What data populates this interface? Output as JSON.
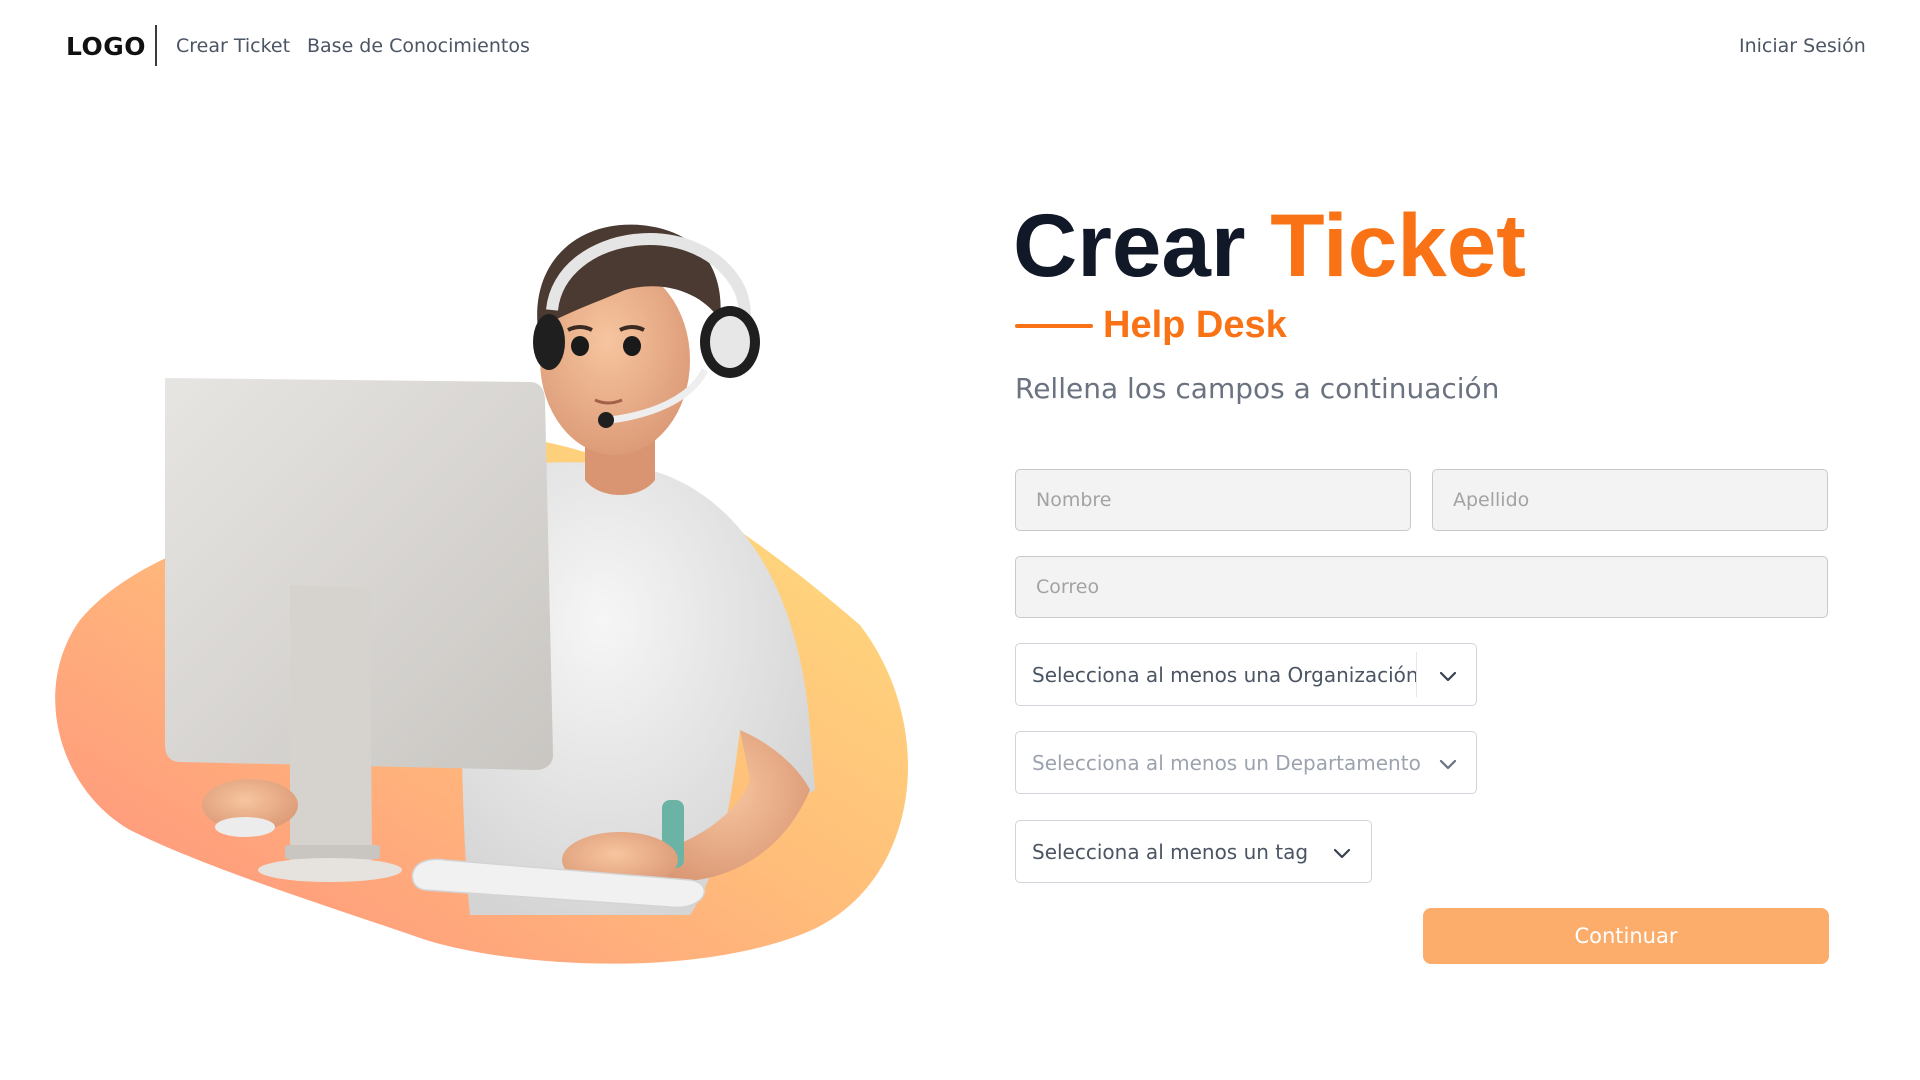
{
  "header": {
    "logo": "LOGO",
    "nav": [
      {
        "label": "Crear Ticket"
      },
      {
        "label": "Base de Conocimientos"
      }
    ],
    "login_label": "Iniciar Sesión"
  },
  "hero": {
    "title_word1": "Crear",
    "title_word2": "Ticket",
    "subtitle": "Help Desk",
    "instructions": "Rellena los campos a continuación"
  },
  "form": {
    "nombre": {
      "placeholder": "Nombre",
      "value": ""
    },
    "apellido": {
      "placeholder": "Apellido",
      "value": ""
    },
    "correo": {
      "placeholder": "Correo",
      "value": ""
    },
    "organizacion": {
      "label": "Selecciona al menos una Organización"
    },
    "departamento": {
      "label": "Selecciona al menos un Departamento"
    },
    "tag": {
      "label": "Selecciona al menos un tag"
    },
    "submit_label": "Continuar"
  },
  "illustration": {
    "subject": "support-agent-with-headset-at-computer"
  },
  "colors": {
    "accent": "#f97316",
    "button": "#fcac6b",
    "title": "#111827",
    "muted": "#6b7280"
  }
}
